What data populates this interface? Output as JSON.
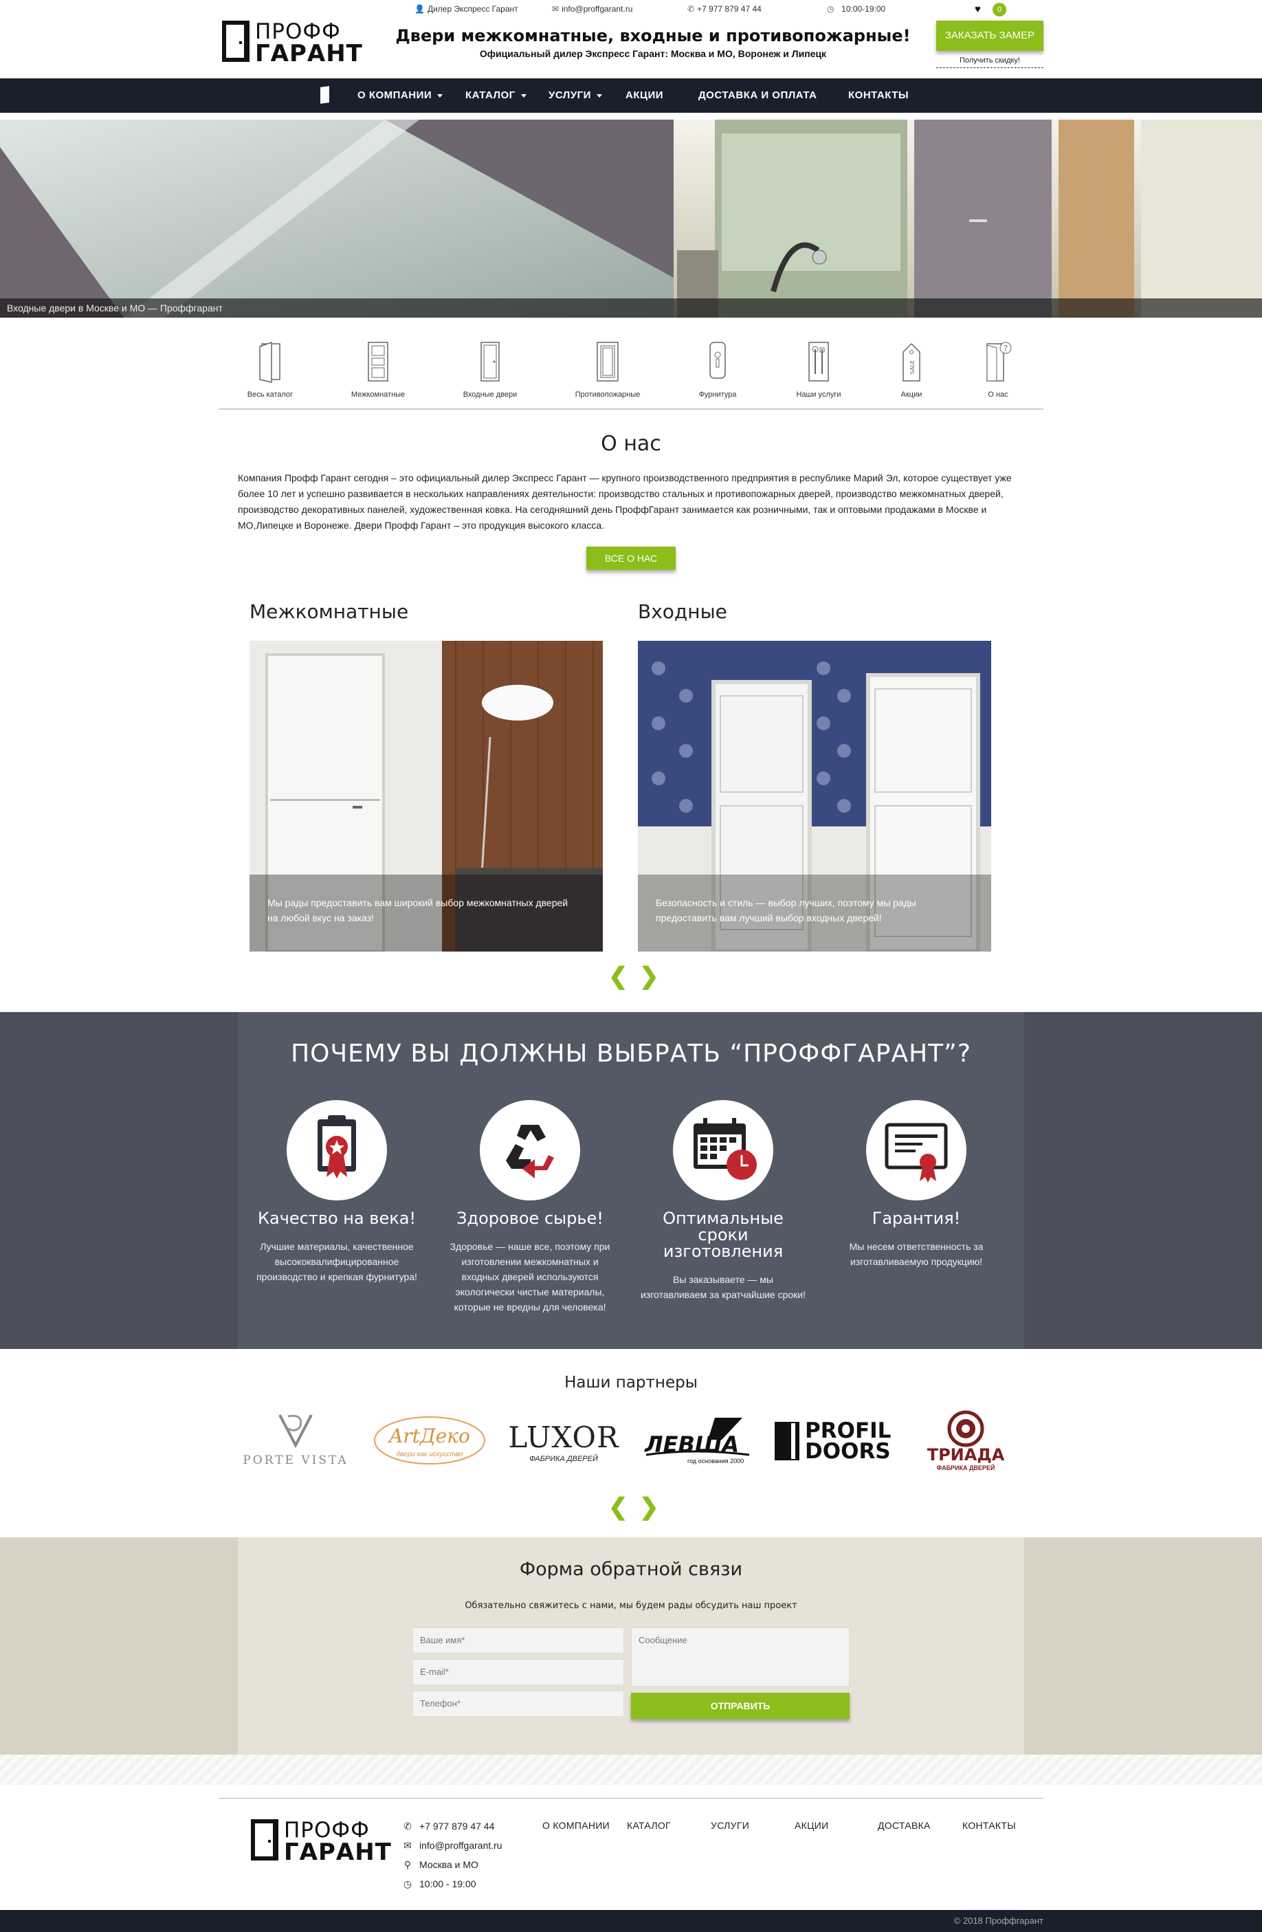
{
  "header": {
    "dealer": "Дилер Экспресс Гарант",
    "email": "info@proffgarant.ru",
    "phone": "+7 977 879 47 44",
    "hours": "10:00-19:00",
    "logo_line1": "ПРОФФ",
    "logo_line2": "ГАРАНТ",
    "title": "Двери межкомнатные, входные и противопожарные!",
    "subtitle": "Официальный дилер Экспресс Гарант: Москва и МО, Воронеж и Липецк",
    "order_button": "ЗАКАЗАТЬ ЗАМЕР",
    "discount_link": "Получить скидку!",
    "cart_count": "0"
  },
  "nav": {
    "items": [
      {
        "label": "О КОМПАНИИ",
        "dropdown": true
      },
      {
        "label": "КАТАЛОГ",
        "dropdown": true
      },
      {
        "label": "УСЛУГИ",
        "dropdown": true
      },
      {
        "label": "АКЦИИ",
        "dropdown": false
      },
      {
        "label": "ДОСТАВКА И ОПЛАТА",
        "dropdown": false
      },
      {
        "label": "КОНТАКТЫ",
        "dropdown": false
      }
    ]
  },
  "hero": {
    "caption": "Входные двери в Москве и МО — Проффгарант"
  },
  "categories": [
    {
      "label": "Весь каталог",
      "icon": "door-catalog-icon"
    },
    {
      "label": "Межкомнатные",
      "icon": "interior-door-icon"
    },
    {
      "label": "Входные двери",
      "icon": "entrance-door-icon"
    },
    {
      "label": "Противопожарные",
      "icon": "fire-door-icon"
    },
    {
      "label": "Фурнитура",
      "icon": "door-handle-icon"
    },
    {
      "label": "Наши услуги",
      "icon": "services-tools-icon"
    },
    {
      "label": "Акции",
      "icon": "sale-tag-icon"
    },
    {
      "label": "О нас",
      "icon": "door-question-icon"
    }
  ],
  "about": {
    "title": "О нас",
    "text": "Компания Профф Гарант сегодня – это официальный дилер Экспресс Гарант — крупного производственного предприятия в республике Марий Эл, которое существует уже более 10 лет и успешно развивается в нескольких направлениях деятельности: производство стальных и противопожарных дверей, производство межкомнатных дверей, производство декоративных панелей, художественная ковка. На сегодняшний день ПроффГарант занимается как розничными, так и оптовыми продажами в Москве и МО,Липецке и Воронеже. Двери Профф Гарант – это продукция высокого класса.",
    "button": "ВСЕ О НАС"
  },
  "cards": [
    {
      "title": "Межкомнатные",
      "text": "Мы рады предоставить вам широкий выбор межкомнатных дверей на любой вкус на заказ!"
    },
    {
      "title": "Входные",
      "text": "Безопасность и стиль — выбор лучших, поэтому мы рады предоставить вам лучший выбор входных дверей!"
    }
  ],
  "slider": {
    "prev": "❮",
    "next": "❯"
  },
  "why": {
    "title": "ПОЧЕМУ ВЫ ДОЛЖНЫ ВЫБРАТЬ   “ПРОФФГАРАНТ”?",
    "features": [
      {
        "title": "Качество на века!",
        "text": "Лучшие материалы, качественное высококвалифицированное производство и крепкая фурнитура!",
        "icon": "quality-certificate-icon"
      },
      {
        "title": "Здоровое сырье!",
        "text": "Здоровье — наше все, поэтому при изготовлении межкомнатных и входных дверей используются экологически чистые материалы, которые не вредны для человека!",
        "icon": "recycle-icon"
      },
      {
        "title": "Оптимальные сроки изготовления",
        "text": "Вы заказываете — мы изготавливаем за кратчайшие сроки!",
        "icon": "calendar-clock-icon"
      },
      {
        "title": "Гарантия!",
        "text": "Мы несем ответственность за изготавливаемую продукцию!",
        "icon": "warranty-certificate-icon"
      }
    ]
  },
  "partners": {
    "title": "Наши партнеры",
    "logos": [
      {
        "name": "PORTE VISTA"
      },
      {
        "name": "ArtДеко",
        "tagline": "двери как искусство"
      },
      {
        "name": "LUXOR",
        "tagline": "ФАБРИКА ДВЕРЕЙ"
      },
      {
        "name": "ЛЕВША",
        "tagline": "год основания 2000"
      },
      {
        "name": "PROFIL",
        "name2": "DOORS"
      },
      {
        "name": "ТРИАДА",
        "tagline": "ФАБРИКА ДВЕРЕЙ"
      }
    ]
  },
  "form": {
    "title": "Форма обратной связи",
    "subtitle": "Обязательно свяжитесь с нами, мы будем рады обсудить наш проект",
    "name_placeholder": "Ваше имя*",
    "email_placeholder": "E-mail*",
    "phone_placeholder": "Телефон*",
    "message_placeholder": "Сообщение",
    "submit": "ОТПРАВИТЬ"
  },
  "footer": {
    "phone": "+7 977 879 47 44",
    "email": "info@proffgarant.ru",
    "city": "Москва и МО",
    "hours": "10:00 - 19:00",
    "nav": [
      "О КОМПАНИИ",
      "КАТАЛОГ",
      "УСЛУГИ",
      "АКЦИИ",
      "ДОСТАВКА",
      "КОНТАКТЫ"
    ],
    "copyright": "© 2018 Проффгарант"
  },
  "colors": {
    "accent": "#8cbd1b",
    "dark": "#1a1f2c",
    "feature_bg": "#545966"
  }
}
